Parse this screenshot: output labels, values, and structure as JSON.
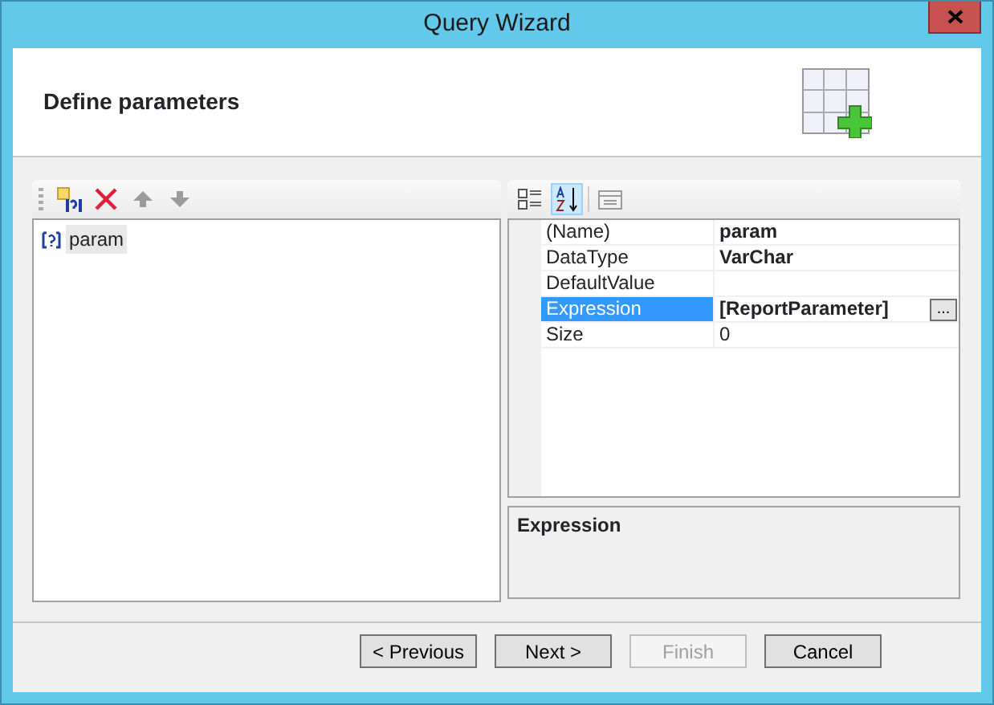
{
  "window": {
    "title": "Query Wizard"
  },
  "header": {
    "title": "Define parameters"
  },
  "parameter_toolbar": [
    {
      "kind": "add",
      "disabled": false
    },
    {
      "kind": "delete",
      "disabled": false
    },
    {
      "kind": "move-up",
      "disabled": true
    },
    {
      "kind": "move-down",
      "disabled": true
    }
  ],
  "parameters": [
    {
      "name": "param",
      "selected": true
    }
  ],
  "property_toolbar": [
    {
      "kind": "categorized",
      "selected": false,
      "disabled": false
    },
    {
      "kind": "alphabetical",
      "selected": true,
      "disabled": false
    },
    {
      "kind": "property-pages",
      "selected": false,
      "disabled": true
    }
  ],
  "properties": [
    {
      "name": "(Name)",
      "value": "param",
      "bold": true,
      "selected": false
    },
    {
      "name": "DataType",
      "value": "VarChar",
      "bold": true,
      "selected": false
    },
    {
      "name": "DefaultValue",
      "selected": false
    },
    {
      "name": "Expression",
      "value": "[ReportParameter]",
      "bold": true,
      "selected": true,
      "editor_button": "..."
    },
    {
      "name": "Size",
      "value": "0",
      "bold": false,
      "selected": false
    }
  ],
  "description": {
    "title": "Expression"
  },
  "buttons": [
    {
      "label": "< Previous",
      "disabled": false
    },
    {
      "label": "Next >",
      "disabled": false
    },
    {
      "label": "Finish",
      "disabled": true
    },
    {
      "label": "Cancel",
      "disabled": false
    }
  ]
}
